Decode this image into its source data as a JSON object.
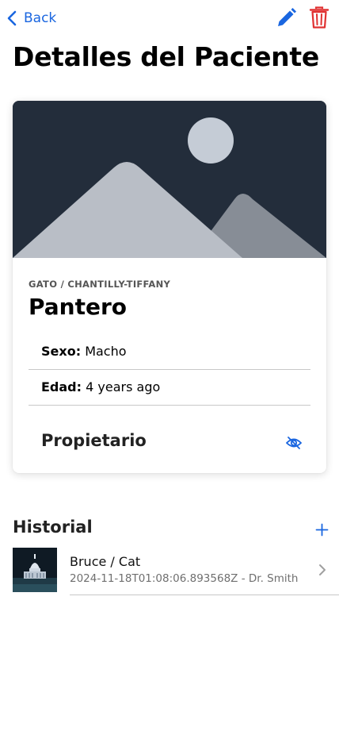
{
  "nav": {
    "back_label": "Back",
    "accent_color": "#1a66e0",
    "danger_color": "#e03131"
  },
  "page": {
    "title": "Detalles del Paciente"
  },
  "patient": {
    "species_breed": "GATO / CHANTILLY-TIFFANY",
    "name": "Pantero",
    "fields": [
      {
        "label": "Sexo:",
        "value": "Macho"
      },
      {
        "label": "Edad:",
        "value": "4 years ago"
      }
    ],
    "owner_section_title": "Propietario",
    "owner_visibility_icon": "eye-off-icon"
  },
  "history": {
    "title": "Historial",
    "add_icon": "plus-icon",
    "items": [
      {
        "name": "Bruce / Cat",
        "meta": "2024-11-18T01:08:06.893568Z - Dr. Smith"
      }
    ]
  }
}
